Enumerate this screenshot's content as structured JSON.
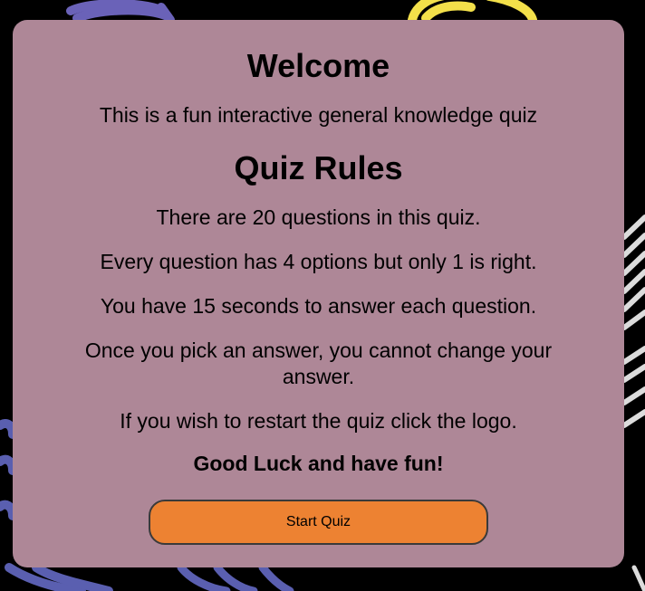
{
  "welcome": {
    "title": "Welcome",
    "intro": "This is a fun interactive general knowledge quiz"
  },
  "rules": {
    "title": "Quiz Rules",
    "items": [
      "There are 20 questions in this quiz.",
      "Every question has 4 options but only 1 is right.",
      "You have 15 seconds to answer each question.",
      "Once you pick an answer, you cannot change your answer.",
      "If you wish to restart the quiz click the logo."
    ],
    "closing": "Good Luck and have fun!"
  },
  "start_button": {
    "label": "Start Quiz"
  },
  "colors": {
    "page_background": "#000000",
    "card_background": "#ae8797",
    "button_background": "#ed8232",
    "decoration_blue": "#5a5fb0",
    "decoration_yellow": "#f3e04a",
    "decoration_white": "#e6e6e6"
  }
}
